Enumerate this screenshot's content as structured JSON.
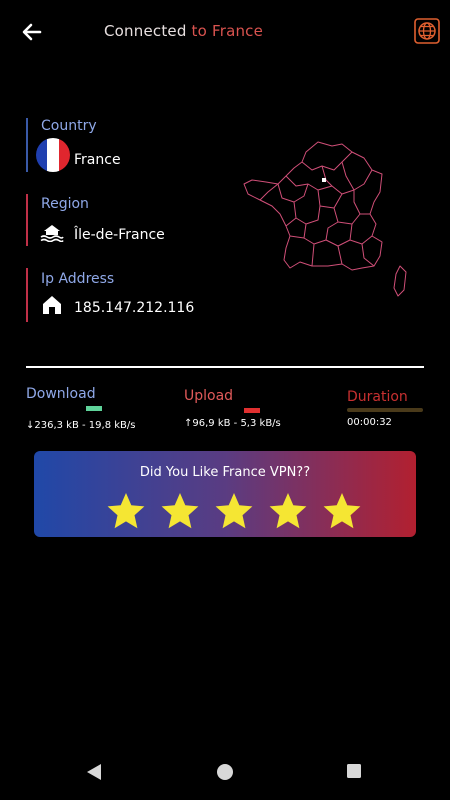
{
  "header": {
    "title_connected": "Connected",
    "title_to": "to France",
    "back_icon": "arrow-left-icon",
    "globe_icon": "globe-icon"
  },
  "info": {
    "country_label": "Country",
    "country_value": "France",
    "region_label": "Region",
    "region_value": "Île-de-France",
    "ip_label": "Ip Address",
    "ip_value": "185.147.212.116"
  },
  "stats": {
    "download_label": "Download",
    "download_value": "↓236,3 kB - 19,8 kB/s",
    "upload_label": "Upload",
    "upload_value": "↑96,9 kB - 5,3 kB/s",
    "duration_label": "Duration",
    "duration_value": "00:00:32"
  },
  "rating": {
    "title": "Did You Like France VPN??",
    "stars": 5
  },
  "colors": {
    "accent_red": "#d9534f",
    "accent_blue": "#8fa8e8",
    "download_green": "#5fd39a",
    "star_yellow": "#f5e633"
  }
}
